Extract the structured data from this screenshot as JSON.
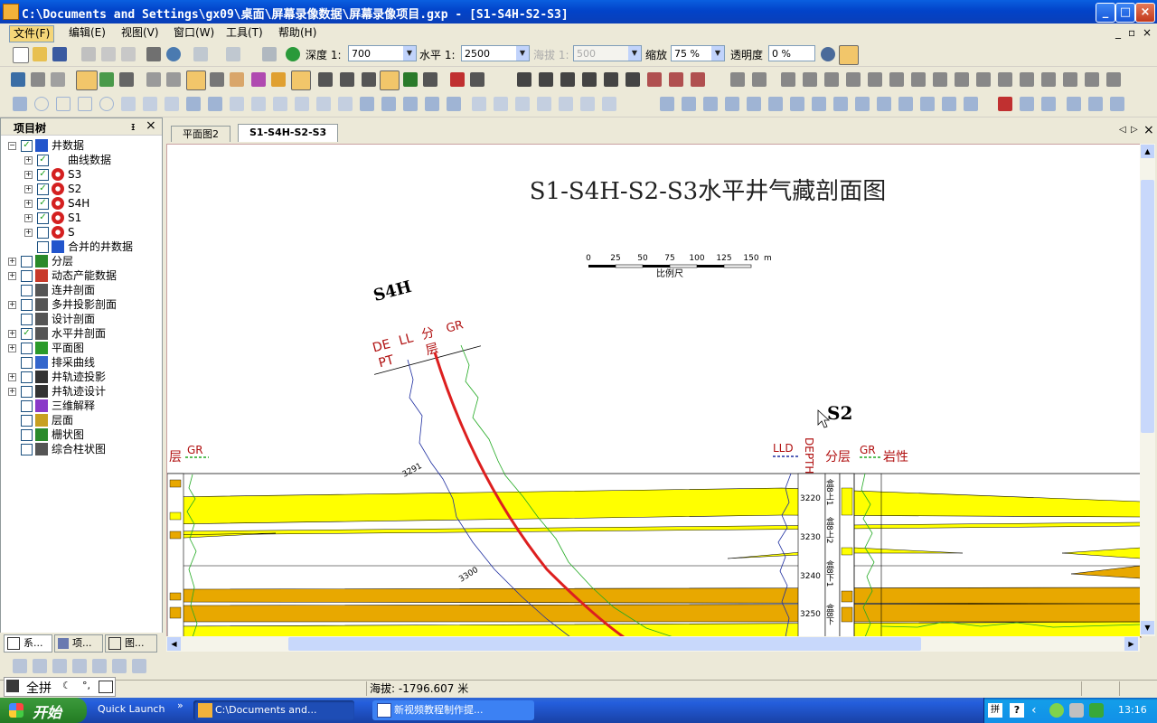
{
  "window": {
    "title": "C:\\Documents and Settings\\gx09\\桌面\\屏幕录像数据\\屏幕录像项目.gxp - [S1-S4H-S2-S3]",
    "min": "_",
    "max": "□",
    "close": "×"
  },
  "menu": [
    "文件(F)",
    "编辑(E)",
    "视图(V)",
    "窗口(W)",
    "工具(T)",
    "帮助(H)"
  ],
  "mdi_controls": [
    "_",
    "▫",
    "×"
  ],
  "toolbar": {
    "depth_label": "深度 1:",
    "depth_value": "700",
    "horizontal_label": "水平 1:",
    "horizontal_value": "2500",
    "elevation_label": "海拔 1:",
    "elevation_value": "500",
    "zoom_label": "缩放",
    "zoom_value": "75 %",
    "opacity_label": "透明度",
    "opacity_value": "0 %"
  },
  "project_tree": {
    "title": "项目树",
    "pin": "ᵻ",
    "close": "×",
    "items": [
      {
        "label": "井数据",
        "level": 0,
        "expand": "-",
        "checked": true,
        "icon": "wells-icon",
        "color": "#2255cc"
      },
      {
        "label": "曲线数据",
        "level": 1,
        "expand": "+",
        "checked": true,
        "icon": "curve-data-icon",
        "color": "#ffffff"
      },
      {
        "label": "S3",
        "level": 1,
        "expand": "+",
        "checked": true,
        "icon": "well-sun-icon",
        "color": "#d42020"
      },
      {
        "label": "S2",
        "level": 1,
        "expand": "+",
        "checked": true,
        "icon": "well-sun-icon",
        "color": "#d42020"
      },
      {
        "label": "S4H",
        "level": 1,
        "expand": "+",
        "checked": true,
        "icon": "well-sun-icon",
        "color": "#d42020"
      },
      {
        "label": "S1",
        "level": 1,
        "expand": "+",
        "checked": true,
        "icon": "well-sun-icon",
        "color": "#d42020"
      },
      {
        "label": "S",
        "level": 1,
        "expand": "+",
        "checked": false,
        "icon": "well-sun-icon",
        "color": "#d42020"
      },
      {
        "label": "合并的井数据",
        "level": 1,
        "expand": "",
        "checked": false,
        "icon": "merged-wells-icon",
        "color": "#2255cc"
      },
      {
        "label": "分层",
        "level": 0,
        "expand": "+",
        "checked": false,
        "icon": "layer-icon",
        "color": "#2a8a2a"
      },
      {
        "label": "动态产能数据",
        "level": 0,
        "expand": "+",
        "checked": false,
        "icon": "production-icon",
        "color": "#c83a2a"
      },
      {
        "label": "连井剖面",
        "level": 0,
        "expand": "",
        "checked": false,
        "icon": "section-icon",
        "color": "#555555"
      },
      {
        "label": "多井投影剖面",
        "level": 0,
        "expand": "+",
        "checked": false,
        "icon": "projection-icon",
        "color": "#555555"
      },
      {
        "label": "设计剖面",
        "level": 0,
        "expand": "",
        "checked": false,
        "icon": "design-section-icon",
        "color": "#555555"
      },
      {
        "label": "水平井剖面",
        "level": 0,
        "expand": "+",
        "checked": true,
        "icon": "horizontal-section-icon",
        "color": "#555555"
      },
      {
        "label": "平面图",
        "level": 0,
        "expand": "+",
        "checked": false,
        "icon": "map-icon",
        "color": "#2a9a2a"
      },
      {
        "label": "排采曲线",
        "level": 0,
        "expand": "",
        "checked": false,
        "icon": "drain-curve-icon",
        "color": "#3366cc"
      },
      {
        "label": "井轨迹投影",
        "level": 0,
        "expand": "+",
        "checked": false,
        "icon": "trajectory-icon",
        "color": "#333333"
      },
      {
        "label": "井轨迹设计",
        "level": 0,
        "expand": "+",
        "checked": false,
        "icon": "trajectory-design-icon",
        "color": "#333333"
      },
      {
        "label": "三维解释",
        "level": 0,
        "expand": "",
        "checked": false,
        "icon": "3d-icon",
        "color": "#8a3ac8"
      },
      {
        "label": "层面",
        "level": 0,
        "expand": "",
        "checked": false,
        "icon": "surface-icon",
        "color": "#c8a020"
      },
      {
        "label": "栅状图",
        "level": 0,
        "expand": "",
        "checked": false,
        "icon": "fence-icon",
        "color": "#2a8a2a"
      },
      {
        "label": "综合柱状图",
        "level": 0,
        "expand": "",
        "checked": false,
        "icon": "column-icon",
        "color": "#555555"
      }
    ]
  },
  "panel_tabs": [
    "系...",
    "项...",
    "图..."
  ],
  "doc_tabs": [
    {
      "label": "平面图2",
      "active": false
    },
    {
      "label": "S1-S4H-S2-S3",
      "active": true
    }
  ],
  "figure": {
    "title": "S1-S4H-S2-S3水平井气藏剖面图",
    "scale_ticks": [
      "0",
      "25",
      "50",
      "75",
      "100",
      "125",
      "150"
    ],
    "scale_unit": "m",
    "scale_label": "比例尺",
    "well_s4h": {
      "name": "S4H",
      "tracks": [
        "DE",
        "PT",
        "LL",
        "分",
        "层",
        "GR"
      ],
      "depth1": "3291",
      "depth2": "3300"
    },
    "well_s2": {
      "name": "S2",
      "tracks": [
        "LLD",
        "DEPTH",
        "分层",
        "GR",
        "岩性"
      ],
      "depths": [
        "3220",
        "3230",
        "3240",
        "3250"
      ],
      "layers": [
        "盒8上1",
        "盒8上2",
        "盒8下1",
        "盒8下"
      ]
    },
    "left_track": [
      "层",
      "GR"
    ]
  },
  "statusbar": {
    "elevation": "海拔: -1796.607 米"
  },
  "ime": {
    "mode": "全拼"
  },
  "taskbar": {
    "start": "开始",
    "quick_launch": "Quick Launch",
    "tasks": [
      "C:\\Documents and...",
      "新视频教程制作提..."
    ],
    "clock": "13:16"
  },
  "colors": {
    "sand_yellow": "#ffff00",
    "sand_orange": "#e8a800",
    "trajectory": "#dd1f1f",
    "gr_curve": "#22aa22",
    "ll_curve": "#1e2ea0"
  }
}
